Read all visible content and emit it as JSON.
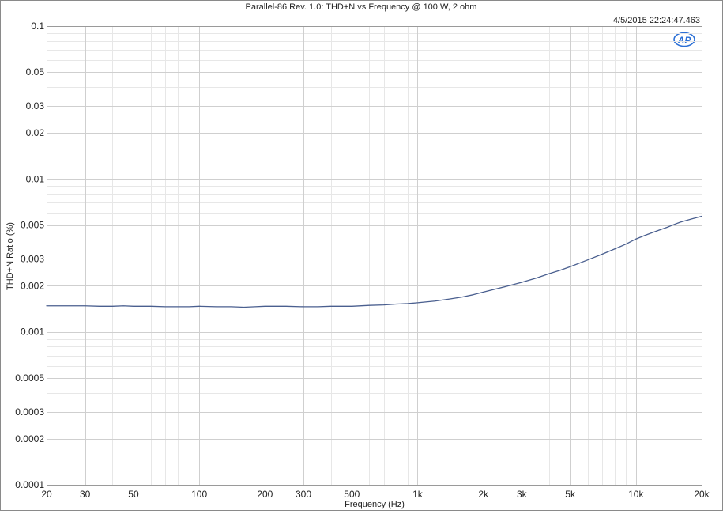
{
  "chart_data": {
    "type": "line",
    "title": "Parallel-86 Rev. 1.0: THD+N vs Frequency @ 100 W, 2 ohm",
    "timestamp": "4/5/2015 22:24:47.463",
    "logo_text": "AP",
    "xlabel": "Frequency (Hz)",
    "ylabel": "THD+N Ratio (%)",
    "x_scale": "log",
    "y_scale": "log",
    "xlim": [
      20,
      20000
    ],
    "ylim": [
      0.0001,
      0.1
    ],
    "grid": true,
    "x_ticks": [
      {
        "value": 20,
        "label": "20"
      },
      {
        "value": 30,
        "label": "30"
      },
      {
        "value": 50,
        "label": "50"
      },
      {
        "value": 100,
        "label": "100"
      },
      {
        "value": 200,
        "label": "200"
      },
      {
        "value": 300,
        "label": "300"
      },
      {
        "value": 500,
        "label": "500"
      },
      {
        "value": 1000,
        "label": "1k"
      },
      {
        "value": 2000,
        "label": "2k"
      },
      {
        "value": 3000,
        "label": "3k"
      },
      {
        "value": 5000,
        "label": "5k"
      },
      {
        "value": 10000,
        "label": "10k"
      },
      {
        "value": 20000,
        "label": "20k"
      }
    ],
    "y_ticks": [
      {
        "value": 0.1,
        "label": "0.1"
      },
      {
        "value": 0.05,
        "label": "0.05"
      },
      {
        "value": 0.03,
        "label": "0.03"
      },
      {
        "value": 0.02,
        "label": "0.02"
      },
      {
        "value": 0.01,
        "label": "0.01"
      },
      {
        "value": 0.005,
        "label": "0.005"
      },
      {
        "value": 0.003,
        "label": "0.003"
      },
      {
        "value": 0.002,
        "label": "0.002"
      },
      {
        "value": 0.001,
        "label": "0.001"
      },
      {
        "value": 0.0005,
        "label": "0.0005"
      },
      {
        "value": 0.0003,
        "label": "0.0003"
      },
      {
        "value": 0.0002,
        "label": "0.0002"
      },
      {
        "value": 0.0001,
        "label": "0.0001"
      }
    ],
    "series": [
      {
        "color": "#4a5f8f",
        "x": [
          20,
          25,
          30,
          35,
          40,
          45,
          50,
          60,
          70,
          80,
          90,
          100,
          120,
          140,
          160,
          180,
          200,
          250,
          300,
          350,
          400,
          500,
          600,
          700,
          800,
          900,
          1000,
          1200,
          1400,
          1600,
          1800,
          2000,
          2500,
          3000,
          3500,
          4000,
          4500,
          5000,
          6000,
          7000,
          8000,
          9000,
          10000,
          11000,
          12000,
          13000,
          14000,
          15000,
          16000,
          18000,
          20000
        ],
        "y": [
          0.00148,
          0.00148,
          0.00148,
          0.00147,
          0.00147,
          0.00148,
          0.00147,
          0.00147,
          0.00146,
          0.00146,
          0.00146,
          0.00147,
          0.00146,
          0.00146,
          0.00145,
          0.00146,
          0.00147,
          0.00147,
          0.00146,
          0.00146,
          0.00147,
          0.00147,
          0.00149,
          0.0015,
          0.00152,
          0.00153,
          0.00155,
          0.00159,
          0.00164,
          0.00169,
          0.00175,
          0.00182,
          0.00197,
          0.00211,
          0.00225,
          0.0024,
          0.00253,
          0.00267,
          0.00295,
          0.00322,
          0.00349,
          0.00375,
          0.00405,
          0.00428,
          0.00448,
          0.00467,
          0.00485,
          0.00505,
          0.00522,
          0.00548,
          0.0057
        ]
      }
    ]
  }
}
